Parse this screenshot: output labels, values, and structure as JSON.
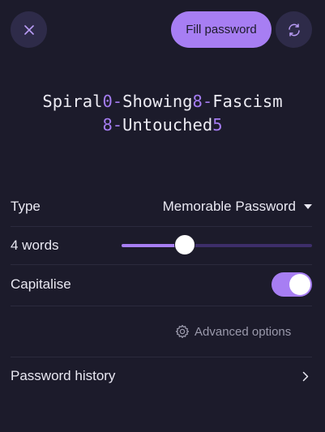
{
  "header": {
    "close_icon": "close-icon",
    "fill_label": "Fill password",
    "regenerate_icon": "refresh-icon"
  },
  "password": {
    "lines": [
      [
        {
          "text": "Spiral",
          "kind": "word"
        },
        {
          "text": "0",
          "kind": "sym"
        },
        {
          "text": "-",
          "kind": "sym"
        },
        {
          "text": "Showing",
          "kind": "word"
        },
        {
          "text": "8",
          "kind": "sym"
        },
        {
          "text": "-",
          "kind": "sym"
        },
        {
          "text": "Fascism",
          "kind": "word"
        }
      ],
      [
        {
          "text": "8",
          "kind": "sym"
        },
        {
          "text": "-",
          "kind": "sym"
        },
        {
          "text": "Untouched",
          "kind": "word"
        },
        {
          "text": "5",
          "kind": "sym"
        }
      ]
    ]
  },
  "options": {
    "type_label": "Type",
    "type_value": "Memorable Password",
    "words_label": "4 words",
    "words_slider_fraction": 0.33,
    "capitalise_label": "Capitalise",
    "capitalise_on": true,
    "advanced_label": "Advanced options"
  },
  "history": {
    "label": "Password history"
  },
  "colors": {
    "background": "#1c1b2b",
    "accent": "#a77ef3",
    "symbol": "#a47cf0",
    "muted": "#9a99ab"
  }
}
